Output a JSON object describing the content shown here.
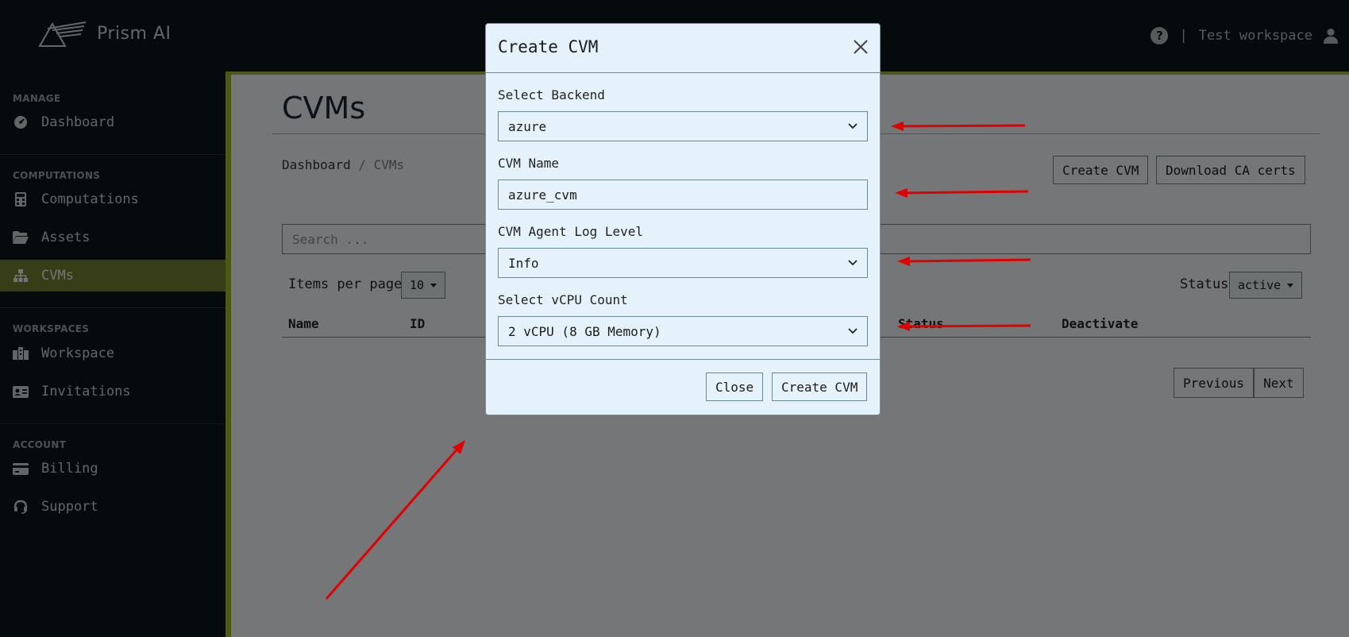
{
  "brand": {
    "name": "Prism AI"
  },
  "header": {
    "separator": "|",
    "workspace": "Test workspace"
  },
  "sidebar": {
    "sections": [
      {
        "title": "MANAGE"
      },
      {
        "title": "COMPUTATIONS"
      },
      {
        "title": "WORKSPACES"
      },
      {
        "title": "ACCOUNT"
      }
    ],
    "items": [
      {
        "label": "Dashboard",
        "icon": "dashboard-icon"
      },
      {
        "label": "Computations",
        "icon": "calculator-icon"
      },
      {
        "label": "Assets",
        "icon": "folder-icon"
      },
      {
        "label": "CVMs",
        "icon": "sitemap-icon",
        "active": true
      },
      {
        "label": "Workspace",
        "icon": "building-icon"
      },
      {
        "label": "Invitations",
        "icon": "id-card-icon"
      },
      {
        "label": "Billing",
        "icon": "credit-card-icon"
      },
      {
        "label": "Support",
        "icon": "headset-icon"
      }
    ]
  },
  "main": {
    "title": "CVMs",
    "breadcrumb": {
      "home": "Dashboard",
      "separator": "/",
      "current": "CVMs"
    },
    "create_button": "Create CVM",
    "download_button": "Download CA certs",
    "search_placeholder": "Search ...",
    "items_per_page_label": "Items per page",
    "items_per_page_value": "10",
    "status_label": "Status",
    "status_value": "active",
    "columns": [
      "Name",
      "ID",
      "Status",
      "Deactivate"
    ],
    "pager": {
      "previous": "Previous",
      "next": "Next"
    }
  },
  "modal": {
    "title": "Create CVM",
    "fields": [
      {
        "label": "Select Backend",
        "value": "azure",
        "type": "select"
      },
      {
        "label": "CVM Name",
        "value": "azure_cvm",
        "type": "text"
      },
      {
        "label": "CVM Agent Log Level",
        "value": "Info",
        "type": "select"
      },
      {
        "label": "Select vCPU Count",
        "value": "2 vCPU (8 GB Memory)",
        "type": "select"
      }
    ],
    "close_button": "Close",
    "submit_button": "Create CVM"
  },
  "colors": {
    "background": "#0b1518",
    "accent": "#9bb12d",
    "active_item": "#6e7a2e",
    "annotation_arrow": "#e00000"
  }
}
